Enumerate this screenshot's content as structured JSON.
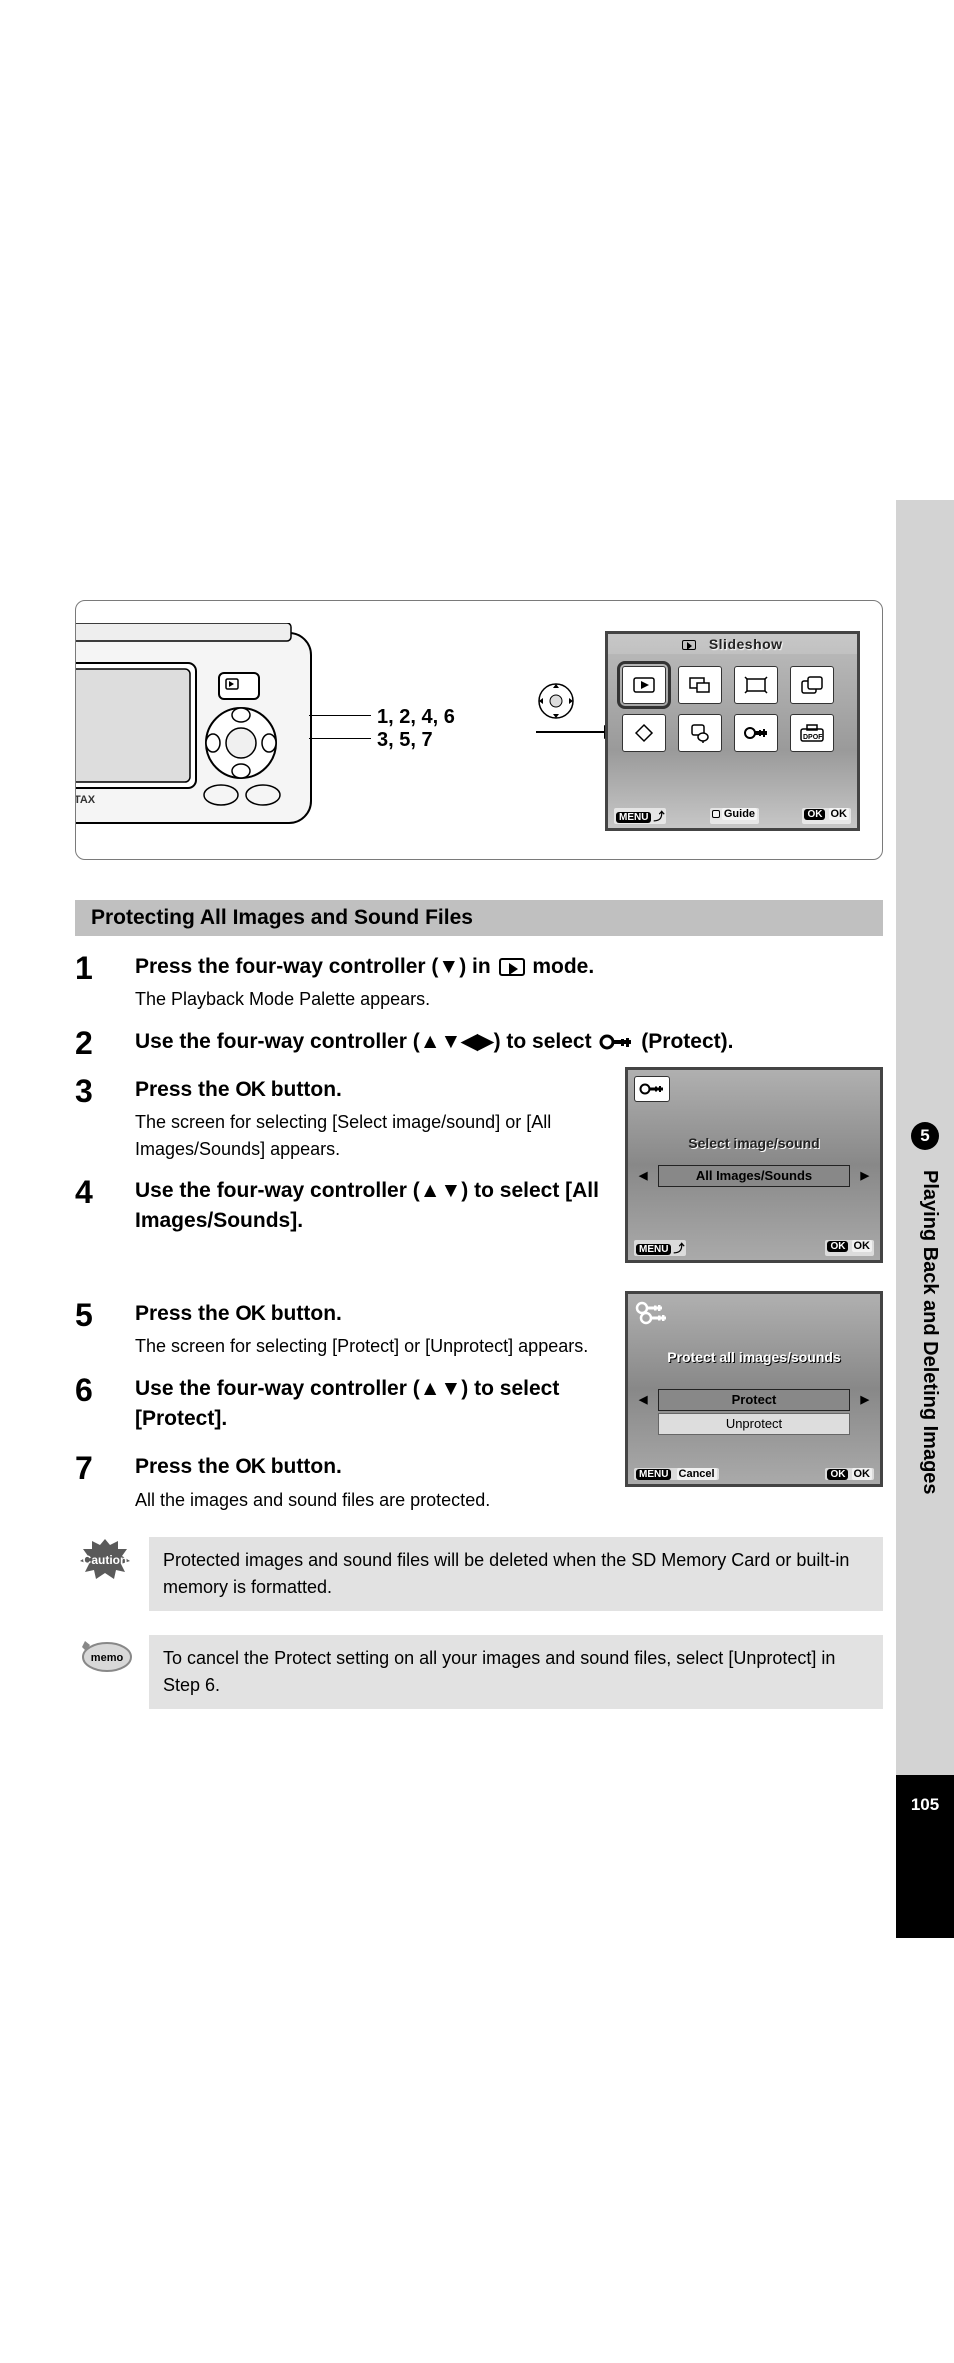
{
  "diagram": {
    "callout1": "1, 2, 4, 6",
    "callout2": "3, 5, 7",
    "palette_title": "Slideshow",
    "footer_menu": "MENU",
    "footer_guide": "Guide",
    "footer_ok": "OK",
    "footer_ok2": "OK"
  },
  "section_title": "Protecting All Images and Sound Files",
  "steps": {
    "s1": {
      "num": "1",
      "title_a": "Press the four-way controller (▼) in ",
      "title_b": " mode.",
      "desc": "The Playback Mode Palette appears."
    },
    "s2": {
      "num": "2",
      "title_a": "Use the four-way controller (▲▼◀▶) to select ",
      "title_b": " (Protect)."
    },
    "s3": {
      "num": "3",
      "title_a": "Press the ",
      "title_b": " button.",
      "desc": "The screen for selecting [Select image/sound] or [All Images/Sounds] appears."
    },
    "s4": {
      "num": "4",
      "title": "Use the four-way controller (▲▼) to select [All Images/Sounds]."
    },
    "s5": {
      "num": "5",
      "title_a": "Press the ",
      "title_b": " button.",
      "desc": "The screen for selecting [Protect] or [Unprotect] appears."
    },
    "s6": {
      "num": "6",
      "title": "Use the four-way controller (▲▼) to select [Protect]."
    },
    "s7": {
      "num": "7",
      "title_a": "Press the ",
      "title_b": " button.",
      "desc": "All the images and sound files are protected."
    }
  },
  "ok_label": "OK",
  "lcd1": {
    "line1": "Select image/sound",
    "line2": "All Images/Sounds",
    "footer_menu": "MENU",
    "footer_ok": "OK",
    "footer_ok2": "OK"
  },
  "lcd2": {
    "title": "Protect all images/sounds",
    "line1": "Protect",
    "line2": "Unprotect",
    "footer_menu": "MENU",
    "footer_cancel": "Cancel",
    "footer_ok": "OK",
    "footer_ok2": "OK"
  },
  "caution_text": "Protected images and sound files will be deleted when the SD Memory Card or built-in memory is formatted.",
  "caution_label": "Caution",
  "memo_text": "To cancel the Protect setting on all your images and sound files, select [Unprotect] in Step 6.",
  "memo_label": "memo",
  "side_label": "Playing Back and Deleting Images",
  "side_chapter": "5",
  "page_number": "105"
}
